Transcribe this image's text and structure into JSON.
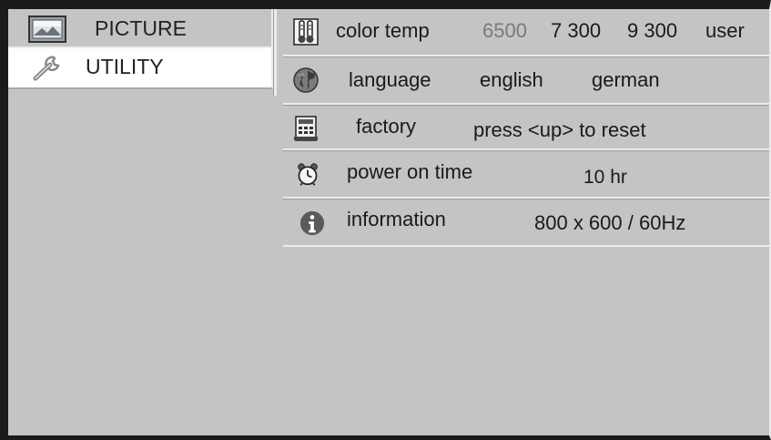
{
  "menu": {
    "items": [
      {
        "label": "PICTURE",
        "icon": "picture-icon"
      },
      {
        "label": "UTILITY",
        "icon": "wrench-icon",
        "selected": true
      }
    ]
  },
  "utility": {
    "color_temp": {
      "label": "color temp",
      "icon": "thermometer-icon",
      "options": [
        "6500",
        "7 300",
        "9 300",
        "user"
      ],
      "dimmed": "6500"
    },
    "language": {
      "label": "language",
      "icon": "globe-icon",
      "options": [
        "english",
        "german"
      ]
    },
    "factory": {
      "label": "factory",
      "icon": "factory-icon",
      "value": "press <up> to reset"
    },
    "power_on_time": {
      "label": "power on time",
      "icon": "clock-icon",
      "value": "10 hr"
    },
    "information": {
      "label": "information",
      "icon": "info-icon",
      "value": "800 x 600 / 60Hz"
    }
  },
  "colors": {
    "background": "#c4c4c4",
    "selected": "#ffffff",
    "border": "#1a1a1a"
  }
}
